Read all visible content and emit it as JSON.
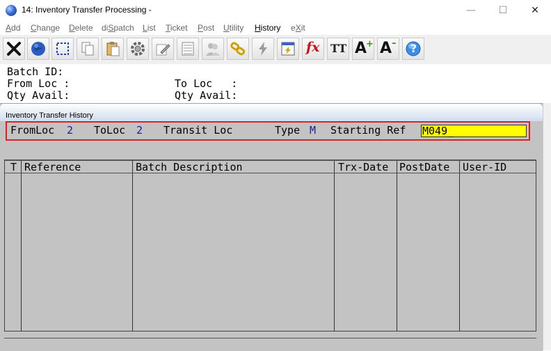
{
  "window": {
    "title": "14: Inventory Transfer Processing -",
    "min": "—",
    "max": "☐",
    "close": "✕"
  },
  "menu": [
    {
      "pre": "",
      "u": "A",
      "post": "dd"
    },
    {
      "pre": "",
      "u": "C",
      "post": "hange"
    },
    {
      "pre": "",
      "u": "D",
      "post": "elete"
    },
    {
      "pre": "di",
      "u": "S",
      "post": "patch"
    },
    {
      "pre": "",
      "u": "L",
      "post": "ist"
    },
    {
      "pre": "",
      "u": "T",
      "post": "icket"
    },
    {
      "pre": "",
      "u": "P",
      "post": "ost"
    },
    {
      "pre": "",
      "u": "U",
      "post": "tility"
    },
    {
      "pre": "",
      "u": "H",
      "post": "istory"
    },
    {
      "pre": "e",
      "u": "X",
      "post": "it"
    }
  ],
  "toolbar": [
    {
      "icon": "close-x-icon"
    },
    {
      "icon": "globe-icon"
    },
    {
      "icon": "select-area-icon"
    },
    {
      "icon": "copy-icon"
    },
    {
      "icon": "paste-icon"
    },
    {
      "icon": "settings-icon"
    },
    {
      "icon": "edit-icon"
    },
    {
      "icon": "list-icon"
    },
    {
      "icon": "users-icon"
    },
    {
      "icon": "link-icon"
    },
    {
      "icon": "lightning-icon"
    },
    {
      "icon": "calc-window-icon"
    },
    {
      "icon": "function-icon",
      "text": "fx"
    },
    {
      "icon": "font-icon",
      "text": "TT"
    },
    {
      "icon": "font-increase-icon",
      "text": "A"
    },
    {
      "icon": "font-decrease-icon",
      "text": "A"
    },
    {
      "icon": "help-icon",
      "text": "?"
    }
  ],
  "header": {
    "batch_label": "Batch ID:",
    "from_loc_label": "From Loc :",
    "to_loc_label": "To Loc   :",
    "qty_avail_label_1": "Qty Avail:",
    "qty_avail_label_2": "Qty Avail:"
  },
  "panel": {
    "title": "Inventory Transfer History",
    "from_loc_label": "FromLoc",
    "from_loc_value": "2",
    "to_loc_label": "ToLoc",
    "to_loc_value": "2",
    "transit_label": "Transit Loc",
    "type_label": "Type",
    "type_value": "M",
    "starting_ref_label": "Starting Ref",
    "starting_ref_value": "M049_"
  },
  "table": {
    "columns": [
      "T",
      "Reference",
      "Batch Description",
      "Trx-Date",
      "PostDate",
      "User-ID"
    ]
  },
  "colors": {
    "accent_yellow": "#ffff00",
    "highlight_red": "#e02020",
    "value_blue": "#1a1a9a",
    "panel_gray": "#c3c3c3"
  }
}
